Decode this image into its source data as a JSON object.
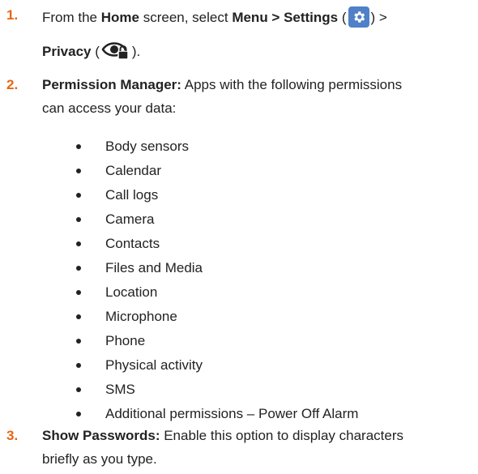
{
  "colors": {
    "number": "#e8650f",
    "text": "#222222",
    "gear_bg": "#4f80c8"
  },
  "step1": {
    "number": "1.",
    "t1": "From the ",
    "b1": "Home",
    "t2": " screen, select ",
    "b2": "Menu > Settings",
    "t3": " (",
    "t4": ") >",
    "b3": "Privacy",
    "t5": " (",
    "t6": ").",
    "settings_icon": "gear-icon",
    "privacy_icon": "eye-lock-icon"
  },
  "step2": {
    "number": "2.",
    "b1": "Permission Manager:",
    "t1": " Apps with the following permissions",
    "t2": "can access your data:",
    "items": [
      "Body sensors",
      "Calendar",
      "Call logs",
      "Camera",
      "Contacts",
      "Files and Media",
      "Location",
      "Microphone",
      "Phone",
      "Physical activity",
      "SMS",
      "Additional permissions – Power Off Alarm"
    ]
  },
  "step3": {
    "number": "3.",
    "b1": "Show Passwords:",
    "t1": " Enable this option to display characters",
    "t2": "briefly as you type."
  }
}
